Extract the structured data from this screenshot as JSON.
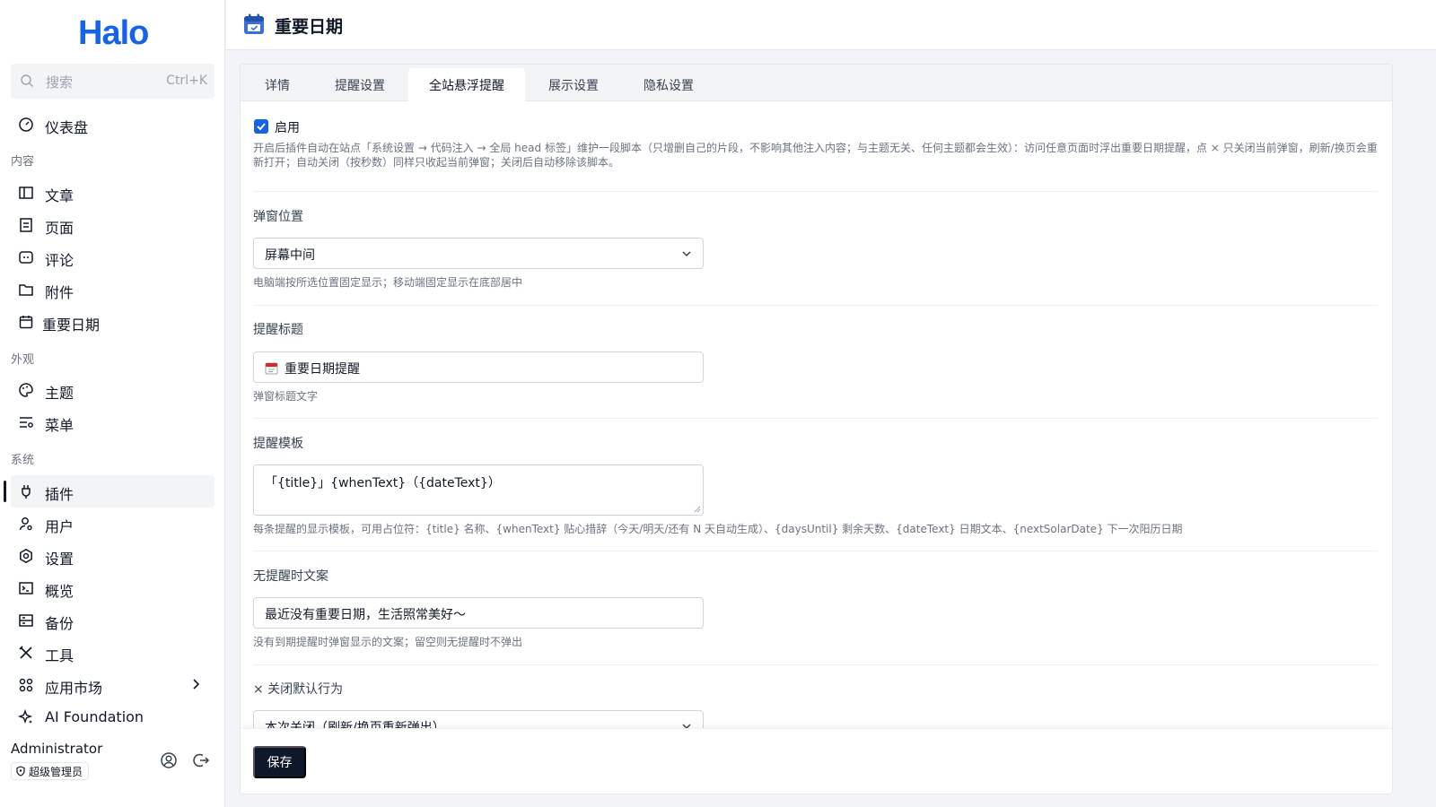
{
  "brand": {
    "logo_text": "Halo",
    "accent": "#1463e8"
  },
  "search": {
    "placeholder": "搜索",
    "shortcut": "Ctrl+K"
  },
  "sidebar": {
    "items_top": [
      {
        "label": "仪表盘",
        "icon": "dashboard-icon"
      }
    ],
    "sections": [
      {
        "title": "内容",
        "items": [
          {
            "label": "文章",
            "icon": "book-icon"
          },
          {
            "label": "页面",
            "icon": "page-icon"
          },
          {
            "label": "评论",
            "icon": "comment-icon"
          },
          {
            "label": "附件",
            "icon": "folder-icon"
          },
          {
            "label": "重要日期",
            "icon": "calendar-icon"
          }
        ]
      },
      {
        "title": "外观",
        "items": [
          {
            "label": "主题",
            "icon": "palette-icon"
          },
          {
            "label": "菜单",
            "icon": "menu-icon"
          }
        ]
      },
      {
        "title": "系统",
        "items": [
          {
            "label": "插件",
            "icon": "plug-icon",
            "active": true
          },
          {
            "label": "用户",
            "icon": "user-icon"
          },
          {
            "label": "设置",
            "icon": "settings-icon"
          },
          {
            "label": "概览",
            "icon": "terminal-icon"
          },
          {
            "label": "备份",
            "icon": "backup-icon"
          },
          {
            "label": "工具",
            "icon": "tools-icon"
          },
          {
            "label": "应用市场",
            "icon": "apps-icon",
            "has_chevron": true
          },
          {
            "label": "AI Foundation",
            "icon": "sparkle-icon"
          }
        ]
      }
    ]
  },
  "user": {
    "name": "Administrator",
    "role": "超级管理员"
  },
  "header": {
    "title": "重要日期",
    "icon": "calendar-icon"
  },
  "tabs": [
    {
      "label": "详情"
    },
    {
      "label": "提醒设置"
    },
    {
      "label": "全站悬浮提醒",
      "active": true
    },
    {
      "label": "展示设置"
    },
    {
      "label": "隐私设置"
    }
  ],
  "form": {
    "enable": {
      "label": "启用",
      "checked": true,
      "help": "开启后插件自动在站点「系统设置 → 代码注入 → 全局 head 标签」维护一段脚本（只增删自己的片段，不影响其他注入内容；与主题无关、任何主题都会生效）：访问任意页面时浮出重要日期提醒，点 × 只关闭当前弹窗，刷新/换页会重新打开；自动关闭（按秒数）同样只收起当前弹窗；关闭后自动移除该脚本。"
    },
    "position": {
      "label": "弹窗位置",
      "value": "屏幕中间",
      "help": "电脑端按所选位置固定显示；移动端固定显示在底部居中"
    },
    "title": {
      "label": "提醒标题",
      "value": "重要日期提醒",
      "help": "弹窗标题文字"
    },
    "template": {
      "label": "提醒模板",
      "value": "「{title}」{whenText}（{dateText}）",
      "help": "每条提醒的显示模板，可用占位符：{title} 名称、{whenText} 贴心措辞（今天/明天/还有 N 天自动生成）、{daysUntil} 剩余天数、{dateText} 日期文本、{nextSolarDate} 下一次阳历日期"
    },
    "empty": {
      "label": "无提醒时文案",
      "value": "最近没有重要日期，生活照常美好～",
      "help": "没有到期提醒时弹窗显示的文案；留空则无提醒时不弹出"
    },
    "close": {
      "label": "× 关闭默认行为",
      "value": "本次关闭（刷新/换页重新弹出）"
    }
  },
  "footer": {
    "save_label": "保存"
  }
}
